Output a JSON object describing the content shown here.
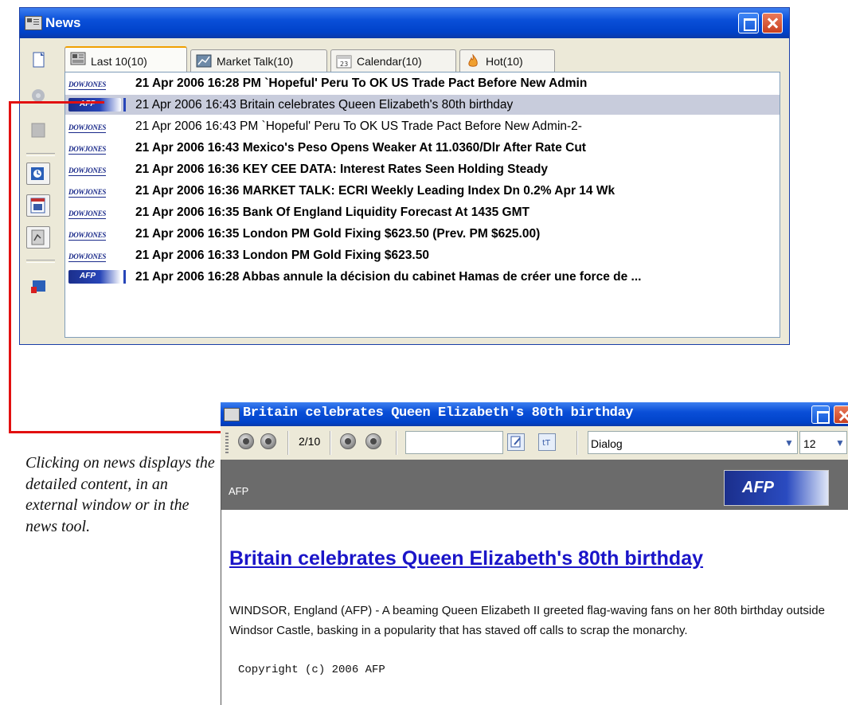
{
  "news_window": {
    "title": "News",
    "tabs": [
      {
        "label": "Last 10(10)",
        "icon": "newspaper-icon",
        "active": true
      },
      {
        "label": "Market Talk(10)",
        "icon": "chart-icon",
        "active": false
      },
      {
        "label": "Calendar(10)",
        "icon": "calendar-icon",
        "active": false
      },
      {
        "label": "Hot(10)",
        "icon": "flame-icon",
        "active": false
      }
    ],
    "rows": [
      {
        "source": "DOWJONES",
        "text": "21 Apr 2006 16:28  PM `Hopeful' Peru To OK US Trade Pact Before New Admin",
        "bold": true,
        "selected": false
      },
      {
        "source": "AFP",
        "text": "21 Apr 2006 16:43  Britain celebrates Queen Elizabeth's 80th birthday",
        "bold": false,
        "selected": true
      },
      {
        "source": "DOWJONES",
        "text": "21 Apr 2006 16:43  PM `Hopeful' Peru To OK US Trade Pact Before New Admin-2-",
        "bold": false,
        "selected": false
      },
      {
        "source": "DOWJONES",
        "text": "21 Apr 2006 16:43  Mexico's Peso Opens Weaker At 11.0360/Dlr After Rate Cut",
        "bold": true,
        "selected": false
      },
      {
        "source": "DOWJONES",
        "text": "21 Apr 2006 16:36  KEY CEE DATA: Interest Rates Seen Holding Steady",
        "bold": true,
        "selected": false
      },
      {
        "source": "DOWJONES",
        "text": "21 Apr 2006 16:36  MARKET TALK: ECRI Weekly Leading Index Dn 0.2% Apr 14 Wk",
        "bold": true,
        "selected": false
      },
      {
        "source": "DOWJONES",
        "text": "21 Apr 2006 16:35  Bank Of England Liquidity Forecast At 1435 GMT",
        "bold": true,
        "selected": false
      },
      {
        "source": "DOWJONES",
        "text": "21 Apr 2006 16:35  London PM Gold Fixing $623.50 (Prev. PM $625.00)",
        "bold": true,
        "selected": false
      },
      {
        "source": "DOWJONES",
        "text": "21 Apr 2006 16:33  London PM Gold Fixing $623.50",
        "bold": true,
        "selected": false
      },
      {
        "source": "AFP",
        "text": "21 Apr 2006 16:28  Abbas annule la décision du cabinet Hamas de créer une force de ...",
        "bold": true,
        "selected": false
      }
    ],
    "sidebar_icons": [
      "new-document-icon",
      "refresh-icon",
      "filter-icon",
      "clock-icon",
      "calendar-icon",
      "chart-settings-icon",
      "export-icon"
    ]
  },
  "caption": {
    "text": "Clicking on news displays the detailed content, in an external window or in the news tool."
  },
  "detail_window": {
    "title": "Britain celebrates Queen Elizabeth's 80th birthday",
    "pager": "2/10",
    "search_value": "",
    "font_value": "Dialog",
    "size_value": "12",
    "source_label": "AFP",
    "logo_text": "AFP",
    "headline": "Britain celebrates Queen Elizabeth's 80th birthday",
    "body": "WINDSOR, England (AFP) - A beaming Queen Elizabeth II greeted flag-waving fans on her 80th birthday outside Windsor Castle, basking in a popularity that has staved off calls to scrap the monarchy.",
    "copyright": "Copyright (c) 2006 AFP"
  },
  "colors": {
    "titlebar": "#0a4fd8",
    "connector": "#e21010",
    "selected_row": "#c8ccdc",
    "headline": "#1a14c8"
  }
}
